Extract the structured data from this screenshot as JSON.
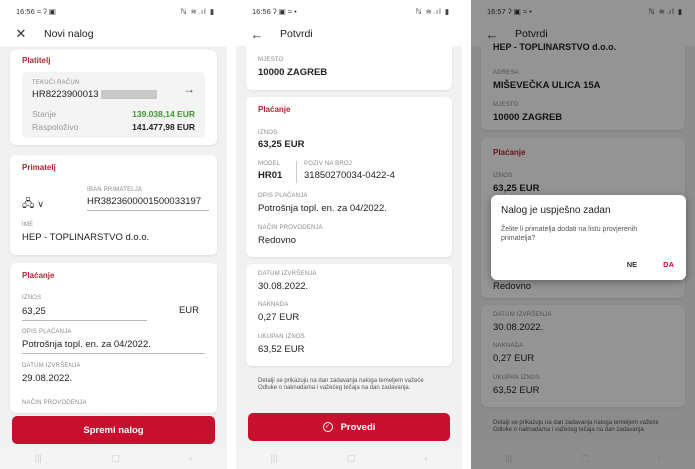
{
  "screen1": {
    "status_time": "16:56",
    "status_left_icons": "≈ ʔ ▣",
    "status_right": "ℕ ≋.ıl ▮",
    "title": "Novi nalog",
    "platitelj": {
      "title": "Platitelj",
      "account_type": "TEKUĆI RAČUN",
      "account_number": "HR8223900013",
      "stanje_label": "Stanje",
      "stanje_value": "139.038,14 EUR",
      "raspolozivo_label": "Raspoloživo",
      "raspolozivo_value": "141.477,98 EUR"
    },
    "primatelj": {
      "title": "Primatelj",
      "iban_label": "IBAN PRIMATELJA",
      "iban": "HR3823600001500033197",
      "ime_label": "IME",
      "ime": "HEP - TOPLINARSTVO d.o.o."
    },
    "placanje": {
      "title": "Plaćanje",
      "iznos_label": "IZNOS",
      "iznos": "63,25",
      "currency": "EUR",
      "opis_label": "OPIS PLAĆANJA",
      "opis": "Potrošnja topl. en. za 04/2022.",
      "datum_label": "DATUM IZVRŠENJA",
      "datum": "29.08.2022.",
      "nacin_label": "NAČIN PROVODENJA"
    },
    "button": "Spremi nalog"
  },
  "screen2": {
    "status_time": "16:56",
    "status_left_icons": "ʔ ▣ ≈ •",
    "status_right": "ℕ ≋.ıl ▮",
    "title": "Potvrdi",
    "mjesto_label": "MJESTO",
    "mjesto": "10000 ZAGREB",
    "placanje_title": "Plaćanje",
    "iznos_label": "IZNOS",
    "iznos": "63,25 EUR",
    "model_label": "MODEL",
    "model": "HR01",
    "poziv_label": "POZIV NA BROJ",
    "poziv": "31850270034-0422-4",
    "opis_label": "OPIS PLAĆANJA",
    "opis": "Potrošnja topl. en. za 04/2022.",
    "nacin_label": "NAČIN PROVODENJA",
    "nacin": "Redovno",
    "datum_label": "DATUM IZVRŠENJA",
    "datum": "30.08.2022.",
    "naknada_label": "NAKNADA",
    "naknada": "0,27 EUR",
    "ukupan_label": "UKUPAN IZNOS",
    "ukupan": "63,52 EUR",
    "note": "Detalji se prikazuju na dan zadavanja naloga temeljem važeće Odluke o naknadama i važećeg tečaja na dan zadavanja.",
    "button": "Provedi"
  },
  "screen3": {
    "status_time": "16:57",
    "status_left_icons": "ʔ ▣ ≈ •",
    "status_right": "ℕ ≋.ıl ▮",
    "title": "Potvrdi",
    "top_cut": "HEP - TOPLINARSTVO d.o.o.",
    "adresa_label": "ADRESA",
    "adresa": "MIŠEVEČKA ULICA 15A",
    "mjesto_label": "MJESTO",
    "mjesto": "10000 ZAGREB",
    "placanje_title": "Plaćanje",
    "iznos_label": "IZNOS",
    "iznos": "63,25 EUR",
    "nacin": "Redovno",
    "datum_label": "DATUM IZVRŠENJA",
    "datum": "30.08.2022.",
    "naknada_label": "NAKNADA",
    "naknada": "0,27 EUR",
    "ukupan_label": "UKUPAN IZNOS",
    "ukupan": "63,52 EUR",
    "note": "Detalji se prikazuju na dan zadavanja naloga temeljem važeće Odluke o naknadama i važećeg tečaja na dan zadavanja.",
    "dialog": {
      "title": "Nalog je uspješno zadan",
      "body": "Želite li primatelja dodati na listu provjerenih primatelja?",
      "no": "NE",
      "yes": "DA"
    }
  },
  "colors": {
    "accent": "#c8102e",
    "green": "#3a9a2a",
    "section_red": "#b4252e"
  }
}
